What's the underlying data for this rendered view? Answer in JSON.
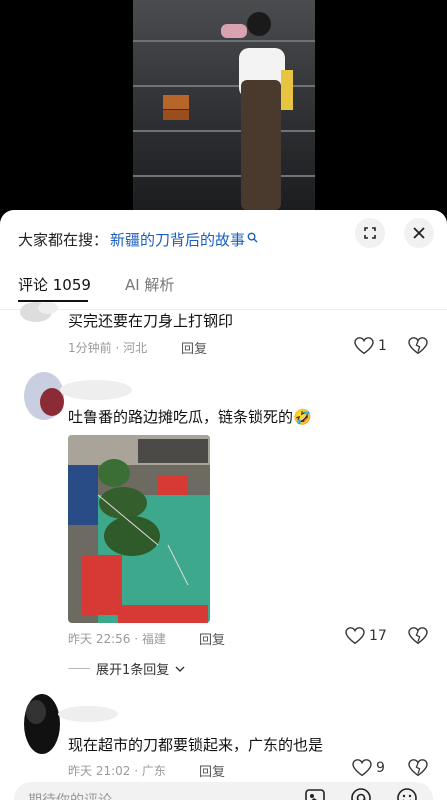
{
  "search": {
    "prefix": "大家都在搜：",
    "query": "新疆的刀背后的故事"
  },
  "tabs": [
    {
      "label": "评论 1059"
    },
    {
      "label": "AI 解析"
    }
  ],
  "comments": [
    {
      "text": "买完还要在刀身上打钢印",
      "time": "1分钟前",
      "location": "河北",
      "reply_label": "回复",
      "likes": "1"
    },
    {
      "text": "吐鲁番的路边摊吃瓜，链条锁死的",
      "emoji": "🤣",
      "time": "昨天 22:56",
      "location": "福建",
      "reply_label": "回复",
      "likes": "17",
      "replies_toggle": "展开1条回复"
    },
    {
      "text": "现在超市的刀都要锁起来，广东的也是",
      "time": "昨天 21:02",
      "location": "广东",
      "reply_label": "回复",
      "likes": "9"
    }
  ],
  "input": {
    "placeholder": "期待你的评论"
  },
  "icons": [
    "expand-icon",
    "close-icon",
    "heart-icon",
    "dislike-icon",
    "chevron-down-icon",
    "image-icon",
    "at-icon",
    "emoji-icon"
  ],
  "colors": {
    "link": "#1b5fbf",
    "sheet_bg": "#ffffff",
    "meta": "#9a9a9a"
  }
}
